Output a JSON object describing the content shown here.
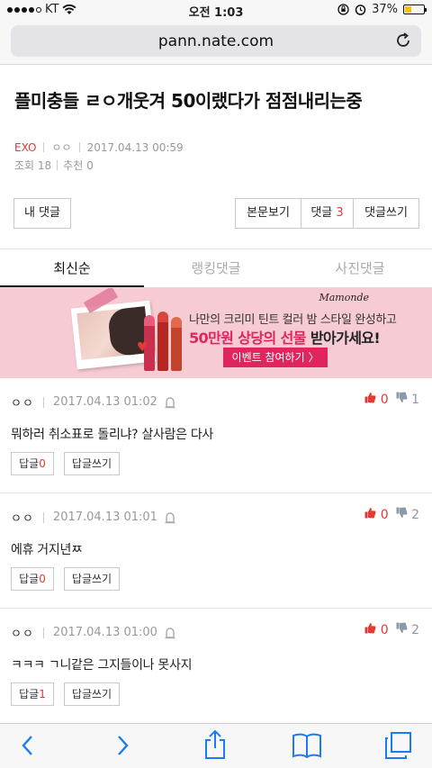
{
  "status_bar": {
    "carrier": "KT",
    "time": "오전 1:03",
    "battery": "37%",
    "battery_level": 0.37
  },
  "browser": {
    "url": "pann.nate.com"
  },
  "article": {
    "title": "플미충들 ㄹㅇ개웃겨 50이랬다가 점점내리는중",
    "category": "EXO",
    "author": "ㅇㅇ",
    "date": "2017.04.13 00:59",
    "views_label": "조회 18",
    "recommend_label": "추천 0"
  },
  "actions": {
    "my_comments": "내 댓글",
    "view_post": "본문보기",
    "comments_label": "댓글",
    "comments_count": "3",
    "write_comment": "댓글쓰기"
  },
  "tabs": [
    {
      "label": "최신순",
      "active": true
    },
    {
      "label": "랭킹댓글",
      "active": false
    },
    {
      "label": "사진댓글",
      "active": false
    }
  ],
  "banner": {
    "brand": "Mamonde",
    "line1": "나만의 크리미 틴트 컬러 밤 스타일 완성하고",
    "line2_highlight": "50만원 상당의 선물",
    "line2_rest": " 받아가세요!",
    "button": "이벤트 참여하기 〉",
    "colors": {
      "background": "#f6cbd3",
      "accent": "#e0245e"
    }
  },
  "comments": [
    {
      "author": "ㅇㅇ",
      "date": "2017.04.13 01:02",
      "up": "0",
      "down": "1",
      "body": "뭐하러 취소표로 돌리냐? 살사람은 다사",
      "reply_label": "답글",
      "reply_count": "0",
      "write_reply": "답글쓰기"
    },
    {
      "author": "ㅇㅇ",
      "date": "2017.04.13 01:01",
      "up": "0",
      "down": "2",
      "body": "에휴 거지년ㅉ",
      "reply_label": "답글",
      "reply_count": "0",
      "write_reply": "답글쓰기"
    },
    {
      "author": "ㅇㅇ",
      "date": "2017.04.13 01:00",
      "up": "0",
      "down": "2",
      "body": "ㅋㅋㅋ ㄱ니같은 그지들이나 못사지",
      "reply_label": "답글",
      "reply_count": "1",
      "write_reply": "답글쓰기"
    }
  ],
  "toolbar": {
    "icons": [
      "back-icon",
      "forward-icon",
      "share-icon",
      "bookmarks-icon",
      "tabs-icon"
    ],
    "accent": "#1a7cf5"
  }
}
